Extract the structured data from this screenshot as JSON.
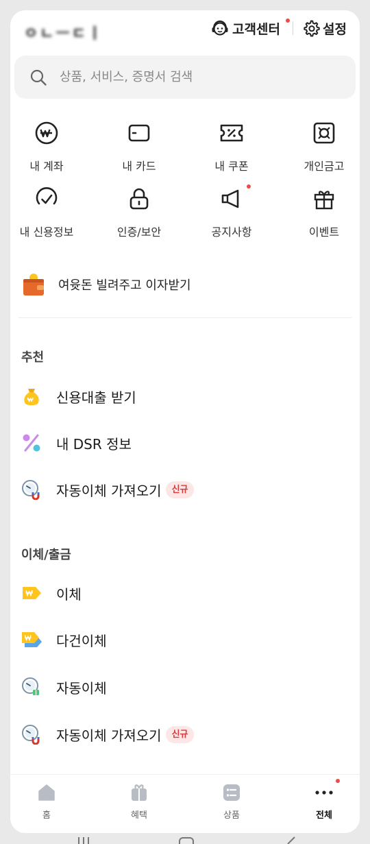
{
  "header": {
    "user_name": "ㅇㄴㅡㄷㅣ",
    "support_label": "고객센터",
    "settings_label": "설정"
  },
  "search": {
    "placeholder": "상품, 서비스, 증명서 검색",
    "value": ""
  },
  "shortcuts": [
    {
      "label": "내 계좌",
      "icon": "won-circle-icon"
    },
    {
      "label": "내 카드",
      "icon": "card-icon"
    },
    {
      "label": "내 쿠폰",
      "icon": "coupon-icon"
    },
    {
      "label": "개인금고",
      "icon": "safe-icon"
    },
    {
      "label": "내 신용정보",
      "icon": "credit-check-icon"
    },
    {
      "label": "인증/보안",
      "icon": "lock-icon"
    },
    {
      "label": "공지사항",
      "icon": "megaphone-icon"
    },
    {
      "label": "이벤트",
      "icon": "gift-icon"
    }
  ],
  "promo": {
    "label": "여윳돈 빌려주고 이자받기",
    "icon": "wallet-icon"
  },
  "sections": {
    "recommend_title": "추천",
    "transfer_title": "이체/출금"
  },
  "recommend_items": [
    {
      "label": "신용대출 받기",
      "icon": "money-bag-icon",
      "badge": ""
    },
    {
      "label": "내 DSR 정보",
      "icon": "percent-icon",
      "badge": ""
    },
    {
      "label": "자동이체 가져오기",
      "icon": "auto-transfer-import-icon",
      "badge": "신규"
    }
  ],
  "transfer_items": [
    {
      "label": "이체",
      "icon": "transfer-icon",
      "badge": ""
    },
    {
      "label": "다건이체",
      "icon": "multi-transfer-icon",
      "badge": ""
    },
    {
      "label": "자동이체",
      "icon": "auto-transfer-icon",
      "badge": ""
    },
    {
      "label": "자동이체 가져오기",
      "icon": "auto-transfer-import-icon",
      "badge": "신규"
    }
  ],
  "bottom_nav": [
    {
      "label": "홈",
      "icon": "home-icon",
      "active": false
    },
    {
      "label": "혜택",
      "icon": "benefit-icon",
      "active": false
    },
    {
      "label": "상품",
      "icon": "product-icon",
      "active": false
    },
    {
      "label": "전체",
      "icon": "more-icon",
      "active": true
    }
  ],
  "colors": {
    "accent_yellow": "#ffc51e",
    "badge_red": "#d73a3a",
    "badge_bg": "#fde6e6",
    "dot_red": "#ef4a4a"
  }
}
